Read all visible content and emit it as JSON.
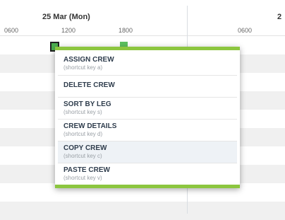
{
  "timeline": {
    "date_label_1": "25 Mar (Mon)",
    "date_label_2": "2",
    "ticks": [
      "0600",
      "1200",
      "1800",
      "0600"
    ]
  },
  "context_menu": {
    "items": [
      {
        "label": "ASSIGN CREW",
        "hint": "(shortcut key a)"
      },
      {
        "label": "DELETE CREW",
        "hint": ""
      },
      {
        "label": "SORT BY LEG",
        "hint": "(shortcut key s)"
      },
      {
        "label": "CREW DETAILS",
        "hint": "(shortcut key d)"
      },
      {
        "label": "COPY CREW",
        "hint": "(shortcut key c)"
      },
      {
        "label": "PASTE CREW",
        "hint": "(shortcut key v)"
      }
    ]
  },
  "colors": {
    "menu_accent": "#8cc63f",
    "duty_block": "#4caf50"
  }
}
